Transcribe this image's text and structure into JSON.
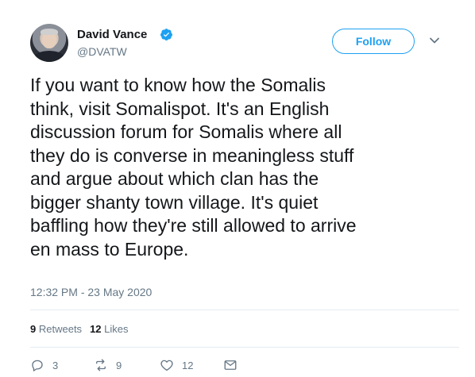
{
  "author": {
    "name": "David Vance",
    "handle": "@DVATW"
  },
  "follow_label": "Follow",
  "tweet": {
    "text": "If you want to know how the Somalis\nthink, visit Somalispot. It's an English\ndiscussion forum for Somalis where all\nthey do is converse in meaningless stuff\nand argue about which clan has the\nbigger shanty town village. It's quiet\nbaffling how they're still allowed to arrive\nen mass to Europe.",
    "timestamp": "12:32 PM - 23 May 2020"
  },
  "stats": {
    "retweets_count": "9",
    "retweets_label": "Retweets",
    "likes_count": "12",
    "likes_label": "Likes"
  },
  "actions": {
    "reply_count": "3",
    "retweet_count": "9",
    "like_count": "12"
  },
  "colors": {
    "accent": "#1da1f2",
    "muted": "#657786",
    "text": "#14171a",
    "divider": "#e6ecf0"
  },
  "icons": [
    "verified-badge-icon",
    "chevron-down-icon",
    "reply-icon",
    "retweet-icon",
    "like-icon",
    "message-icon"
  ]
}
